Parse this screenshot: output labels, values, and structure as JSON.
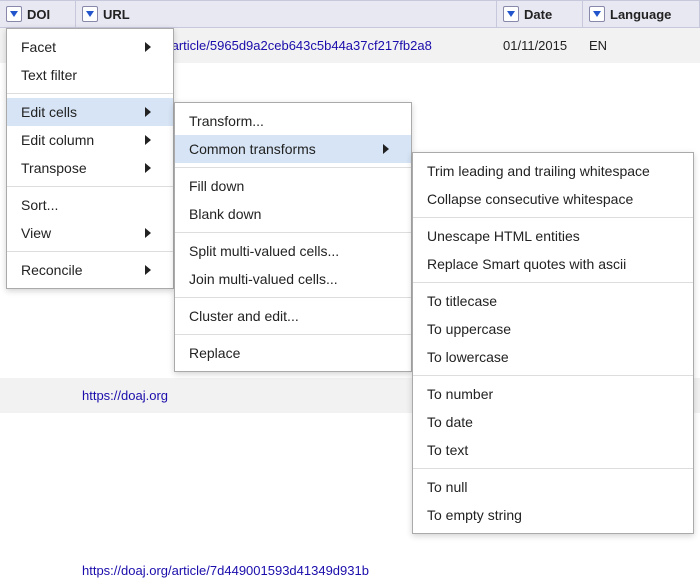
{
  "columns": {
    "doi": "DOI",
    "url": "URL",
    "date": "Date",
    "language": "Language"
  },
  "rows": [
    {
      "url": "https://doaj.org/article/5965d9a2ceb643c5b44a37cf217fb2a8",
      "date": "01/11/2015",
      "lang": "EN"
    },
    {
      "url": "https://doaj.org",
      "date": "",
      "lang": ""
    },
    {
      "url": "https://doaj.org/article/7d449001593d41349d931b",
      "date": "",
      "lang": ""
    }
  ],
  "menu1": {
    "facet": "Facet",
    "text_filter": "Text filter",
    "edit_cells": "Edit cells",
    "edit_column": "Edit column",
    "transpose": "Transpose",
    "sort": "Sort...",
    "view": "View",
    "reconcile": "Reconcile"
  },
  "menu2": {
    "transform": "Transform...",
    "common_transforms": "Common transforms",
    "fill_down": "Fill down",
    "blank_down": "Blank down",
    "split": "Split multi-valued cells...",
    "join": "Join multi-valued cells...",
    "cluster": "Cluster and edit...",
    "replace": "Replace"
  },
  "menu3": {
    "trim": "Trim leading and trailing whitespace",
    "collapse": "Collapse consecutive whitespace",
    "unescape": "Unescape HTML entities",
    "smartquotes": "Replace Smart quotes with ascii",
    "titlecase": "To titlecase",
    "uppercase": "To uppercase",
    "lowercase": "To lowercase",
    "tonumber": "To number",
    "todate": "To date",
    "totext": "To text",
    "tonull": "To null",
    "toempty": "To empty string"
  }
}
